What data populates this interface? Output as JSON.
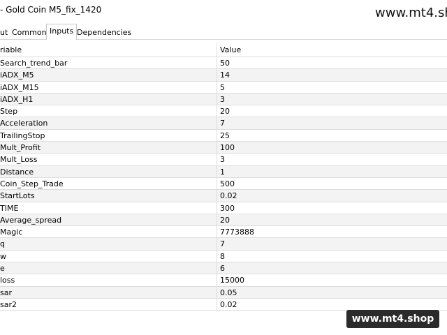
{
  "window": {
    "title": "- Gold Coin M5_fix_1420",
    "watermark_top": "www.mt4.sh"
  },
  "tabs": [
    {
      "label": "ut"
    },
    {
      "label": "Common"
    },
    {
      "label": "Inputs"
    },
    {
      "label": "Dependencies"
    }
  ],
  "table": {
    "headers": {
      "name": "riable",
      "value": "Value"
    },
    "rows": [
      {
        "name": "Search_trend_bar",
        "value": "50"
      },
      {
        "name": "iADX_M5",
        "value": "14"
      },
      {
        "name": "iADX_M15",
        "value": "5"
      },
      {
        "name": "iADX_H1",
        "value": "3"
      },
      {
        "name": "Step",
        "value": "20"
      },
      {
        "name": "Acceleration",
        "value": "7"
      },
      {
        "name": "TrailingStop",
        "value": "25"
      },
      {
        "name": "Mult_Profit",
        "value": "100"
      },
      {
        "name": "Mult_Loss",
        "value": "3"
      },
      {
        "name": "Distance",
        "value": "1"
      },
      {
        "name": "Coin_Step_Trade",
        "value": "500"
      },
      {
        "name": "StartLots",
        "value": "0.02"
      },
      {
        "name": "TIME",
        "value": "300"
      },
      {
        "name": "Average_spread",
        "value": "20"
      },
      {
        "name": "Magic",
        "value": "7773888"
      },
      {
        "name": "q",
        "value": "7"
      },
      {
        "name": "w",
        "value": "8"
      },
      {
        "name": "e",
        "value": "6"
      },
      {
        "name": "loss",
        "value": "15000"
      },
      {
        "name": "sar",
        "value": "0.05"
      },
      {
        "name": "sar2",
        "value": "0.02"
      }
    ]
  },
  "badge": {
    "text": "www.mt4.shop"
  }
}
